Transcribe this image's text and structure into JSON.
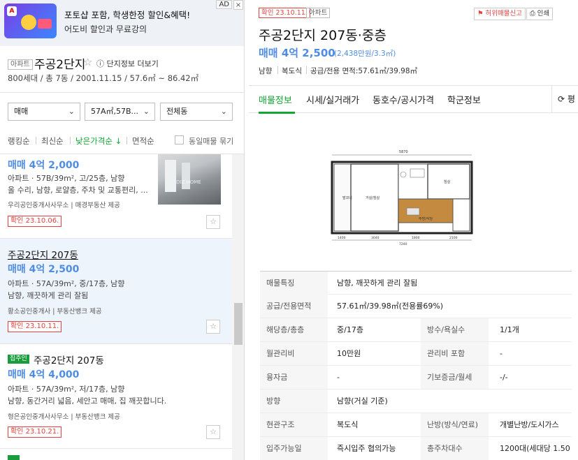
{
  "ad": {
    "title": "포토샵 포함, 학생한정 할인&혜택!",
    "subtitle": "어도비 할인과 무료강의",
    "tag": "AD",
    "close": "×",
    "logo_letter": "A"
  },
  "complex": {
    "type": "아파트",
    "name": "주공2단지",
    "more_link": "단지정보 더보기",
    "meta": "800세대 / 총 7동 / 2001.11.15 / 57.6㎡ ~ 86.42㎡"
  },
  "filters": {
    "trade": "매매",
    "area": "57A㎡,57B...",
    "dong": "전체동",
    "chevron": "⌄"
  },
  "sort": {
    "ranking": "랭킹순",
    "latest": "최신순",
    "low_price": "낮은가격순 ↓",
    "area": "면적순",
    "group_label": "동일매물 묶기"
  },
  "listings": [
    {
      "title": "",
      "price": "매매 4억 2,000",
      "spec": "아파트 · 57B/39m², 고/25층, 남향",
      "desc": "올 수리, 남향, 로얄층, 주차 및 교통편리, ...",
      "agent": "우리공인중개사사무소 | 매경부동산 제공",
      "confirm": "확인 23.10.06.",
      "thumb_text": "DIZ HOME"
    },
    {
      "title": "주공2단지 207동",
      "price": "매매 4억 2,500",
      "spec": "아파트 · 57A/39m², 중/17층, 남향",
      "desc": "남향, 깨끗하게 관리 잘됨",
      "agent": "황소공인중개사 | 부동산뱅크 제공",
      "confirm": "확인 23.10.11."
    },
    {
      "badge": "집주인",
      "title": "주공2단지 207동",
      "price": "매매 4억 4,000",
      "spec": "아파트 · 57A/39m², 저/17층, 남향",
      "desc": "남향, 동간거리 넓음, 세안고 매매, 집 깨끗합니다.",
      "agent": "형은공인중개사사무소 | 부동산뱅크 제공",
      "confirm": "확인 23.10.21."
    }
  ],
  "fav_icon": "☆",
  "detail": {
    "confirm": "확인 23.10.11.",
    "type": "아파트",
    "report": "허위매물신고",
    "print": "인쇄",
    "title": "주공2단지 207동·중층",
    "price": "매매 4억 2,500",
    "price_per_area": "(2,438만원/3.3㎡)",
    "direction": "남향",
    "structure": "복도식",
    "area_summary": "공급/전용 면적:57.61㎡/39.98㎡",
    "tabs": [
      "매물정보",
      "시세/실거래가",
      "동호수/공시가격",
      "학군정보"
    ],
    "tab_more": "⟳ 평",
    "floorplan_labels": {
      "balcony": "발코니",
      "living": "거실/침실",
      "room": "침실",
      "kitchen": "주방/식당",
      "top_dim": "5870",
      "bottom_dims": [
        "1400",
        "3040",
        "1800",
        "2100"
      ],
      "total": "7240"
    },
    "rows": [
      {
        "label": "매물특징",
        "value": "남향, 깨끗하게 관리 잘됨"
      },
      {
        "label": "공급/전용면적",
        "value": "57.61㎡/39.98㎡(전용률69%)"
      },
      {
        "label": "해당층/총층",
        "value": "중/17층",
        "label2": "방수/욕실수",
        "value2": "1/1개"
      },
      {
        "label": "월관리비",
        "value": "10만원",
        "label2": "관리비 포함",
        "value2": "-"
      },
      {
        "label": "융자금",
        "value": "-",
        "label2": "기보증금/월세",
        "value2": "-/-"
      },
      {
        "label": "방향",
        "value": "남향(거실 기준)"
      },
      {
        "label": "현관구조",
        "value": "복도식",
        "label2": "난방(방식/연료)",
        "value2": "개별난방/도시가스"
      },
      {
        "label": "입주가능일",
        "value": "즉시입주 협의가능",
        "label2": "총주차대수",
        "value2": "1200대(세대당 1.50"
      }
    ]
  }
}
